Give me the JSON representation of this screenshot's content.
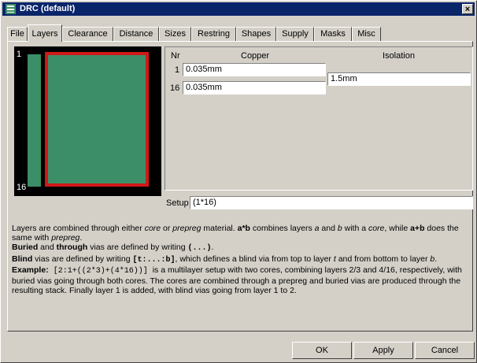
{
  "window": {
    "title": "DRC (default)",
    "close_label": "×"
  },
  "tabs": [
    "File",
    "Layers",
    "Clearance",
    "Distance",
    "Sizes",
    "Restring",
    "Shapes",
    "Supply",
    "Masks",
    "Misc"
  ],
  "active_tab": "Layers",
  "preview": {
    "top_label": "1",
    "bottom_label": "16",
    "colors": {
      "copper": "#3c8e68",
      "core": "#d01818",
      "background": "#000000"
    }
  },
  "layers_table": {
    "headers": {
      "nr": "Nr",
      "copper": "Copper",
      "isolation": "Isolation"
    },
    "rows": [
      {
        "nr": "1",
        "copper": "0.035mm"
      },
      {
        "nr": "16",
        "copper": "0.035mm"
      }
    ],
    "isolation_value": "1.5mm"
  },
  "setup": {
    "label": "Setup",
    "value": "(1*16)"
  },
  "description": {
    "p1_a": "Layers are combined through either ",
    "p1_core": "core",
    "p1_b": " or ",
    "p1_prepreg": "prepreg",
    "p1_c": " material. ",
    "p1_axb": "a*b",
    "p1_d": " combines layers ",
    "p1_a_it": "a",
    "p1_e": " and ",
    "p1_b_it": "b",
    "p1_f": " with a ",
    "p1_core2": "core",
    "p1_g": ", while ",
    "p1_apb": "a+b",
    "p1_h": " does the same with ",
    "p1_prepreg2": "prepreg",
    "p1_i": ".",
    "p2_buried": "Buried",
    "p2_a": " and ",
    "p2_through": "through",
    "p2_b": " vias are defined by writing ",
    "p2_code": "(...)",
    "p2_c": ".",
    "p3_blind": "Blind",
    "p3_a": " vias are defined by writing ",
    "p3_code": "[t:...:b]",
    "p3_b": ", which defines a blind via from top to layer ",
    "p3_t": "t",
    "p3_c": " and from bottom to layer ",
    "p3_bb": "b",
    "p3_d": ".",
    "p4_example": "Example:",
    "p4_code": " [2:1+((2*3)+(4*16))] ",
    "p4_a": "is a multilayer setup with two cores, combining layers 2/3 and 4/16, respectively, with buried vias going through both cores. The cores are combined through a prepreg and buried vias are produced through the resulting stack. Finally layer 1 is added, with blind vias going from layer 1 to 2."
  },
  "buttons": {
    "ok": "OK",
    "apply": "Apply",
    "cancel": "Cancel"
  }
}
